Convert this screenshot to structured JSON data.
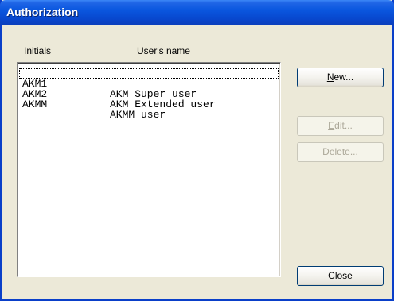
{
  "window": {
    "title": "Authorization"
  },
  "columns": {
    "initials": "Initials",
    "name": "User's name"
  },
  "users": [
    {
      "initials": "AKM1",
      "name": "AKM Super user"
    },
    {
      "initials": "AKM2",
      "name": "AKM Extended user"
    },
    {
      "initials": "AKMM",
      "name": "AKMM user"
    }
  ],
  "buttons": {
    "new": {
      "key": "N",
      "rest": "ew..."
    },
    "edit": {
      "key": "E",
      "rest": "dit..."
    },
    "delete": {
      "key": "D",
      "rest": "elete..."
    },
    "close": "Close"
  }
}
